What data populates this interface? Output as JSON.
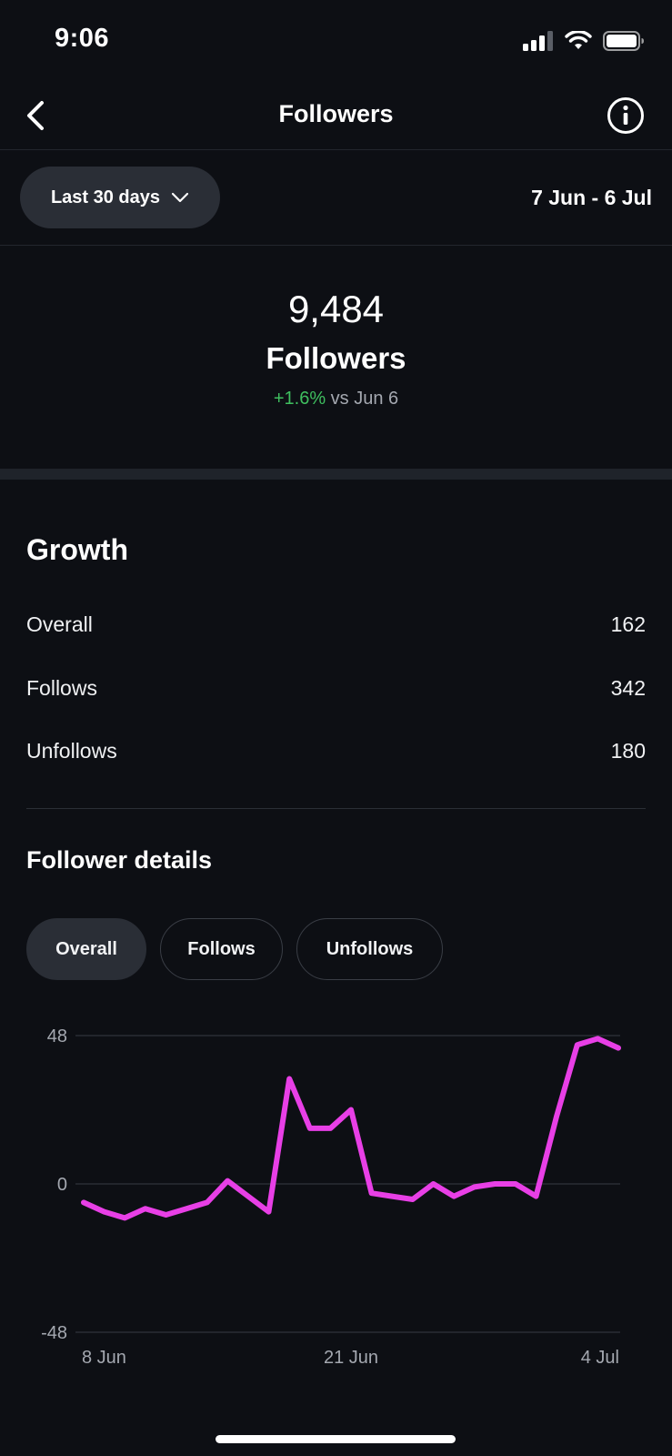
{
  "status_bar": {
    "time": "9:06"
  },
  "nav": {
    "title": "Followers",
    "back_icon": "chevron-left-icon",
    "info_icon": "info-icon"
  },
  "range": {
    "dropdown_label": "Last 30 days",
    "date_range": "7 Jun - 6 Jul"
  },
  "summary": {
    "count": "9,484",
    "label": "Followers",
    "change_pct": "+1.6%",
    "change_context": "vs Jun 6",
    "change_color": "#3fbf5f"
  },
  "growth": {
    "title": "Growth",
    "rows": [
      {
        "label": "Overall",
        "value": "162"
      },
      {
        "label": "Follows",
        "value": "342"
      },
      {
        "label": "Unfollows",
        "value": "180"
      }
    ]
  },
  "details": {
    "title": "Follower details",
    "tabs": [
      {
        "label": "Overall",
        "active": true
      },
      {
        "label": "Follows",
        "active": false
      },
      {
        "label": "Unfollows",
        "active": false
      }
    ]
  },
  "chart_data": {
    "type": "line",
    "series_color": "#e83fe6",
    "y_ticks": [
      "48",
      "0",
      "-48"
    ],
    "ylim": [
      -48,
      48
    ],
    "x_tick_labels": [
      "8 Jun",
      "21 Jun",
      "4 Jul"
    ],
    "x_tick_index": [
      0,
      13,
      26
    ],
    "grid": true,
    "series": [
      {
        "values": [
          -6,
          -9,
          -11,
          -8,
          -10,
          -8,
          -6,
          1,
          -4,
          -9,
          34,
          18,
          18,
          24,
          -3,
          -4,
          -5,
          0,
          -4,
          -1,
          0,
          0,
          -4,
          22,
          45,
          47,
          44
        ]
      }
    ]
  }
}
